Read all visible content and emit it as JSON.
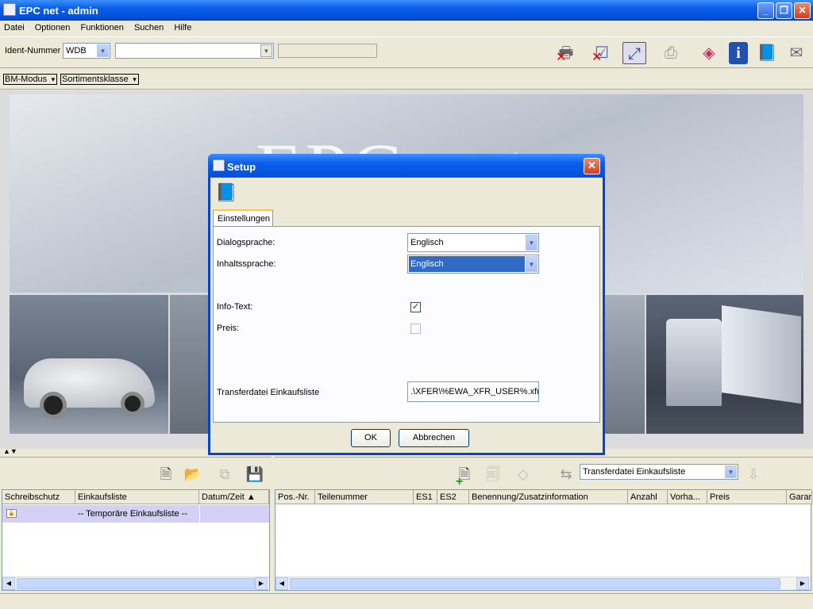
{
  "window": {
    "title": "EPC net - admin"
  },
  "menu": [
    "Datei",
    "Optionen",
    "Funktionen",
    "Suchen",
    "Hilfe"
  ],
  "toolbar": {
    "ident_label": "Ident-Nummer",
    "ident_prefix": "WDB",
    "ident_value": "",
    "ident_extra": ""
  },
  "modebar": {
    "mode": "BM-Modus",
    "sortiment": "Sortimentsklasse"
  },
  "banner": {
    "logo_text": "EPC net"
  },
  "dialog": {
    "title": "Setup",
    "tab": "Einstellungen",
    "dialogsprache_label": "Dialogsprache:",
    "dialogsprache_value": "Englisch",
    "inhaltssprache_label": "Inhaltssprache:",
    "inhaltssprache_value": "Englisch",
    "infotext_label": "Info-Text:",
    "infotext_checked": true,
    "preis_label": "Preis:",
    "preis_checked": false,
    "transfer_label": "Transferdatei Einkaufsliste",
    "transfer_value": ".\\XFER\\%EWA_XFR_USER%.xfr",
    "ok": "OK",
    "cancel": "Abbrechen"
  },
  "left_grid": {
    "headers": [
      "Schreibschutz",
      "Einkaufsliste",
      "Datum/Zeit"
    ],
    "rows": [
      {
        "list": "-- Temporäre Einkaufsliste --",
        "date": ""
      }
    ]
  },
  "right_grid": {
    "transfer_select": "Transferdatei Einkaufsliste",
    "headers": [
      "Pos.-Nr.",
      "Teilenummer",
      "ES1",
      "ES2",
      "Benennung/Zusatzinformation",
      "Anzahl",
      "Vorha...",
      "Preis",
      "Garan"
    ]
  }
}
